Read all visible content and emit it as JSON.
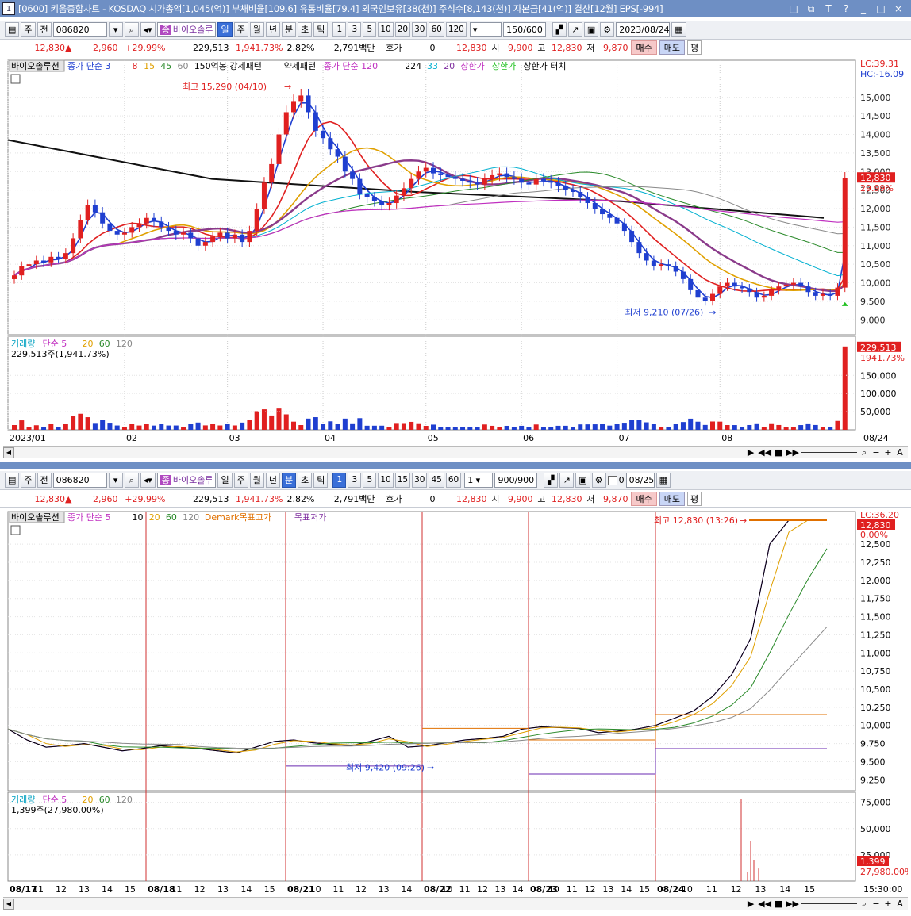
{
  "title": "[0600] 키움종합차트 - KOSDAQ 시가총액[1,045(억)] 부채비율[109.6] 유통비율[79.4] 외국인보유[38(천)] 주식수[8,143(천)] 자본금[41(억)] 결산[12월] EPS[-994]",
  "window_buttons": [
    "□",
    "⧉",
    "T",
    "?",
    "_",
    "□",
    "×"
  ],
  "top": {
    "toolbar": {
      "period_buttons": [
        "주",
        "전"
      ],
      "code": "086820",
      "stock_tag": "종",
      "stock_name": "바이오솔루",
      "tf_buttons": [
        "일",
        "주",
        "월",
        "년",
        "분",
        "초",
        "틱"
      ],
      "active_tf": "일",
      "num_buttons": [
        "1",
        "3",
        "5",
        "10",
        "20",
        "30",
        "60",
        "120"
      ],
      "count": "150/600",
      "date": "2023/08/24"
    },
    "quote": {
      "price": "12,830",
      "arrow": "▲",
      "change": "2,960",
      "pct": "+29.99%",
      "volume": "229,513",
      "vol_pct": "1,941.73%",
      "turnover": "2.82%",
      "amount": "2,791백만",
      "hoga_label": "호가",
      "hoga": "0",
      "hoga_price": "12,830",
      "open_label": "시",
      "open": "9,900",
      "high_label": "고",
      "high": "12,830",
      "low_label": "저",
      "low": "9,870",
      "buy": "매수",
      "sell": "매도",
      "ping": "평"
    },
    "legend": [
      {
        "text": "바이오솔루션",
        "color": "#000000",
        "box": true
      },
      {
        "text": "종가 단순 3",
        "color": "#1f3fd0"
      },
      {
        "text": "8",
        "color": "#e02020"
      },
      {
        "text": "15",
        "color": "#e0a000"
      },
      {
        "text": "45",
        "color": "#2a8a2a"
      },
      {
        "text": "60",
        "color": "#888888"
      },
      {
        "text": "150억봉 강세패턴",
        "color": "#000000"
      },
      {
        "text": "약세패턴",
        "color": "#000000"
      },
      {
        "text": "종가 단순 120",
        "color": "#c030c0"
      },
      {
        "text": "224",
        "color": "#000000"
      },
      {
        "text": "33",
        "color": "#00b0d0"
      },
      {
        "text": "20",
        "color": "#8030a0"
      },
      {
        "text": "상한가",
        "color": "#c030c0"
      },
      {
        "text": "상한가",
        "color": "#20c020"
      },
      {
        "text": "상한가 터치",
        "color": "#000000"
      }
    ],
    "lc": "LC:39.31",
    "hc": "HC:-16.09",
    "price_tag": "12,830",
    "pct_tag": "29.99%",
    "high_note": "최고 15,290 (04/10)",
    "low_note": "최저 9,210 (07/26)",
    "vol_legend": [
      {
        "text": "거래량",
        "color": "#00a0c0"
      },
      {
        "text": "단순 5",
        "color": "#c030c0"
      },
      {
        "text": "20",
        "color": "#e0a000"
      },
      {
        "text": "60",
        "color": "#2a8a2a"
      },
      {
        "text": "120",
        "color": "#888888"
      }
    ],
    "vol_info": "229,513주(1,941.73%)",
    "vol_tag": "229,513",
    "vol_pct_tag": "1941.73%",
    "x_labels": [
      "2023/01",
      "02",
      "03",
      "04",
      "05",
      "06",
      "07",
      "08"
    ],
    "x_right": "08/24"
  },
  "bottom": {
    "toolbar": {
      "period_buttons": [
        "주",
        "전"
      ],
      "code": "086820",
      "stock_tag": "종",
      "stock_name": "바이오솔루",
      "tf_buttons": [
        "일",
        "주",
        "월",
        "년",
        "분",
        "초",
        "틱"
      ],
      "active_tf": "분",
      "num_buttons": [
        "1",
        "3",
        "5",
        "10",
        "15",
        "30",
        "45",
        "60"
      ],
      "active_num": "1",
      "sel": "1",
      "count": "900/900",
      "date_check": "0",
      "date": "08/25"
    },
    "legend": [
      {
        "text": "바이오솔루션",
        "color": "#000000",
        "box": true
      },
      {
        "text": "종가 단순 5",
        "color": "#c030c0"
      },
      {
        "text": "10",
        "color": "#000000"
      },
      {
        "text": "20",
        "color": "#e0a000"
      },
      {
        "text": "60",
        "color": "#2a8a2a"
      },
      {
        "text": "120",
        "color": "#888888"
      },
      {
        "text": "Demark목표고가",
        "color": "#e07000"
      },
      {
        "text": "목표저가",
        "color": "#8030a0"
      }
    ],
    "lc": "LC:36.20",
    "hc": "HC:-2.60",
    "price_tag": "12,830",
    "pct_tag": "0.00%",
    "high_note": "최고 12,830 (13:26)",
    "low_note": "최저 9,420 (09:26)",
    "vol_legend": [
      {
        "text": "거래량",
        "color": "#00a0c0"
      },
      {
        "text": "단순 5",
        "color": "#c030c0"
      },
      {
        "text": "20",
        "color": "#e0a000"
      },
      {
        "text": "60",
        "color": "#2a8a2a"
      },
      {
        "text": "120",
        "color": "#888888"
      }
    ],
    "vol_info": "1,399주(27,980.00%)",
    "vol_tag": "1,399",
    "vol_pct_tag": "27,980.00%",
    "x_labels": [
      "08/17",
      "11",
      "12",
      "13",
      "14",
      "15",
      "08/18",
      "11",
      "12",
      "13",
      "14",
      "15",
      "08/21",
      "10",
      "11",
      "12",
      "13",
      "14",
      "08/22",
      "10",
      "11",
      "12",
      "13",
      "14",
      "08/23",
      "10",
      "11",
      "12",
      "13",
      "14",
      "15",
      "08/24",
      "10",
      "11",
      "12",
      "13",
      "14",
      "15"
    ],
    "x_right": "15:30:00"
  },
  "chart_data": [
    {
      "type": "candlestick",
      "title": "바이오솔루션 일봉",
      "ylim": [
        8600,
        16000
      ],
      "y_ticks": [
        9000,
        9500,
        10000,
        10500,
        11000,
        11500,
        12000,
        12500,
        13000,
        13500,
        14000,
        14500,
        15000
      ],
      "months": [
        "2023/01",
        "02",
        "03",
        "04",
        "05",
        "06",
        "07",
        "08"
      ],
      "series": [
        {
          "name": "종가",
          "values": [
            10200,
            10450,
            10500,
            10600,
            10550,
            10700,
            10650,
            10800,
            11200,
            11700,
            12100,
            11900,
            11600,
            11400,
            11300,
            11350,
            11500,
            11600,
            11750,
            11650,
            11500,
            11400,
            11300,
            11350,
            11200,
            11000,
            11100,
            11250,
            11350,
            11200,
            11300,
            11100,
            11400,
            12000,
            12700,
            13200,
            14000,
            14600,
            14900,
            15050,
            14600,
            14100,
            13900,
            13600,
            13400,
            13000,
            12800,
            12400,
            12300,
            12200,
            12100,
            12150,
            12350,
            12550,
            12800,
            13000,
            13100,
            12950,
            12900,
            12850,
            12800,
            12750,
            12700,
            12650,
            12800,
            12900,
            12950,
            12850,
            12800,
            12700,
            12650,
            12800,
            12750,
            12700,
            12600,
            12500,
            12450,
            12300,
            12150,
            12000,
            11850,
            11750,
            11600,
            11400,
            11100,
            10800,
            10600,
            10450,
            10500,
            10450,
            10300,
            10100,
            9800,
            9600,
            9500,
            9700,
            9900,
            10000,
            9900,
            9850,
            9750,
            9600,
            9650,
            9800,
            9900,
            9950,
            10000,
            9900,
            9750,
            9650,
            9700,
            9650,
            9870,
            12830
          ]
        },
        {
          "name": "MA224",
          "values": [
            13850,
            12800,
            12450,
            12200,
            11750
          ]
        }
      ],
      "high": {
        "value": 15290,
        "date": "04/10"
      },
      "low": {
        "value": 9210,
        "date": "07/26"
      },
      "last": {
        "close": 12830,
        "pct": 29.99
      },
      "volume": {
        "last": 229513,
        "ticks": [
          50000,
          100000,
          150000
        ]
      }
    },
    {
      "type": "line",
      "title": "바이오솔루션 1분봉",
      "ylim": [
        9100,
        12950
      ],
      "y_ticks": [
        9250,
        9500,
        9750,
        10000,
        10250,
        10500,
        10750,
        11000,
        11250,
        11500,
        11750,
        12000,
        12250,
        12500
      ],
      "x": [
        "08/17",
        "08/18",
        "08/21",
        "08/22",
        "08/23",
        "08/24"
      ],
      "series": [
        {
          "name": "종가",
          "values": [
            9950,
            9800,
            9700,
            9720,
            9750,
            9700,
            9650,
            9680,
            9720,
            9700,
            9680,
            9650,
            9620,
            9700,
            9780,
            9800,
            9760,
            9740,
            9720,
            9780,
            9850,
            9700,
            9720,
            9760,
            9800,
            9820,
            9850,
            9950,
            9980,
            9970,
            9960,
            9900,
            9920,
            9950,
            10000,
            10100,
            10200,
            10400,
            10700,
            11200,
            12500,
            12830,
            12830,
            12830
          ]
        }
      ],
      "demark_high": [
        {
          "from": "08/22",
          "to": "08/23",
          "value": 9960
        },
        {
          "from": "08/24",
          "value": 10150
        }
      ],
      "demark_low": [
        {
          "from": "08/21",
          "to": "08/23",
          "value": 9440
        },
        {
          "from": "08/23",
          "value": 9330
        },
        {
          "from": "08/24",
          "value": 9680
        }
      ],
      "high": {
        "value": 12830,
        "time": "13:26"
      },
      "low": {
        "value": 9420,
        "time": "09:26"
      },
      "volume": {
        "last": 1399,
        "ticks": [
          25000,
          50000,
          75000
        ]
      }
    }
  ]
}
